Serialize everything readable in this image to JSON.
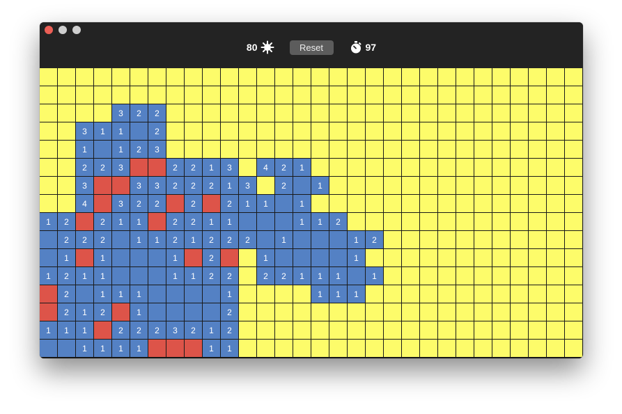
{
  "header": {
    "mines_remaining": "80",
    "mine_icon": "sun-mine-icon",
    "reset_label": "Reset",
    "timer_icon": "stopwatch-icon",
    "timer_value": "97"
  },
  "colors": {
    "hidden": "#fdfc6a",
    "revealed": "#5481c4",
    "flagged": "#dd5449",
    "titlebar": "#232323",
    "reset_button": "#5c5c5c"
  },
  "board": {
    "columns": 30,
    "rows": [
      "hhhhhhhhhhhhhhhhhhhhhhhhhhhhhh",
      "hhhhhhhhhhhhhhhhhhhhhhhhhhhhhh",
      "hhhh322hhhhhhhhhhhhhhhhhhhhhhh",
      "hh311.2hhhhhhhhhhhhhhhhhhhhhhh",
      "hh1.123hhhhhhhhhhhhhhhhhhhhhhh",
      "hh223FF2213h421hhhhhhhhhhhhhhh",
      "hh3FF3322213h2.1hhhhhhhhhhhhhh",
      "hh4F322F2F211.1hhhhhhhhhhhhhhh",
      "12F211F2211...112hhhhhhhhhhhhh",
      ".222.1121222.1...12hhhhhhhhhhh",
      ".1F1...1F2Fh1....1hhhhhhhhhhhh",
      "1211...1122h22111.1hhhhhhhhhhh",
      "F2.111....1hhhh111hhhhhhhhhhhh",
      "F212F1....2hhhhhhhhhhhhhhhhhhh",
      "111F2223212hhhhhhhhhhhhhhhhhhh",
      "..1111FFF11hhhhhhhhhhhhhhhhhhh"
    ]
  }
}
